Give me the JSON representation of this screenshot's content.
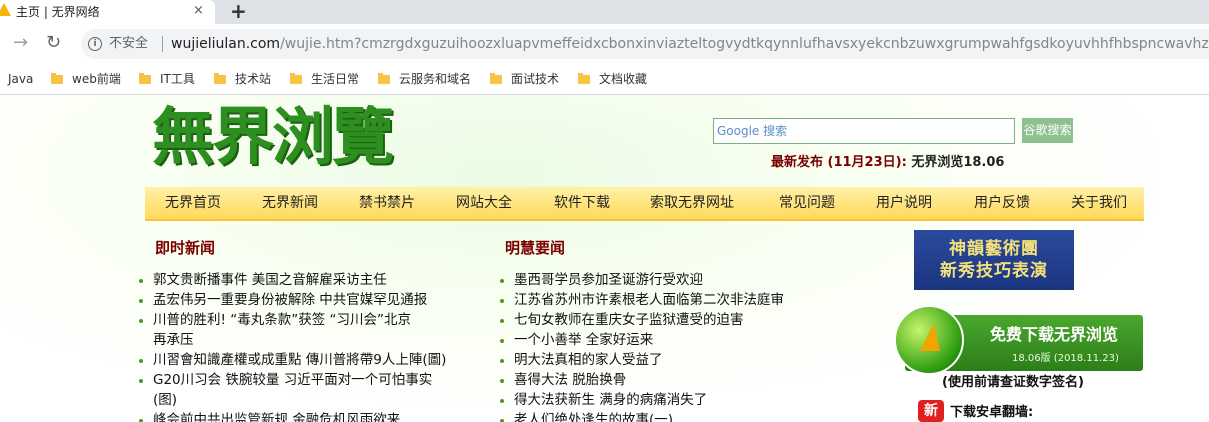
{
  "browser": {
    "tab_title": "主页 | 无界网络",
    "tab_close": "×",
    "new_tab": "+",
    "insecure_label": "不安全",
    "url_host": "wujieliulan.com",
    "url_path": "/wujie.htm?cmzrgdxguzuihoozxluapvmeffeidxcbonxinviazteltogvydtkqynnlufhavsxyekcnbzuwxgrumpwahfgsdkoyuvhhfhbspncwavhzefatyu..."
  },
  "bookmarks": [
    "Java",
    "web前端",
    "IT工具",
    "技术站",
    "生活日常",
    "云服务和域名",
    "面试技术",
    "文档收藏"
  ],
  "header": {
    "logo_text": "無界浏覽",
    "search_placeholder": "Google 搜索",
    "search_button": "谷歌搜索",
    "release_label": "最新发布 (11月23日):",
    "release_version": "无界浏览18.06"
  },
  "menu": [
    "无界首页",
    "无界新闻",
    "禁书禁片",
    "网站大全",
    "软件下载",
    "索取无界网址",
    "常见问题",
    "用户说明",
    "用户反馈",
    "关于我们"
  ],
  "left_column": {
    "title": "即时新闻",
    "items": [
      "郭文贵断播事件 美国之音解雇采访主任",
      "孟宏伟另一重要身份被解除 中共官媒罕见通报",
      "川普的胜利! “毒丸条款”获签 “习川会”北京",
      "再承压",
      "川習會知識產權或成重點 傳川普將帶9人上陣(圖)",
      "G20川习会 铁腕较量 习近平面对一个可怕事实",
      "(图)",
      "峰会前中共出监管新规 金融危机风雨欲来"
    ]
  },
  "middle_column": {
    "title": "明慧要闻",
    "items": [
      "墨西哥学员参加圣诞游行受欢迎",
      "江苏省苏州市许素根老人面临第二次非法庭审",
      "七旬女教师在重庆女子监狱遭受的迫害",
      "一个小善举 全家好运来",
      "明大法真相的家人受益了",
      "喜得大法 脱胎换骨",
      "得大法获新生 满身的病痛消失了",
      "老人们绝处逢生的故事(一)"
    ]
  },
  "sidebar": {
    "banner_line1": "神韻藝術團",
    "banner_line2": "新秀技巧表演",
    "download_text": "免费下载无界浏览",
    "download_version": "18.06版 (2018.11.23)",
    "signature_note": "(使用前请查证数字签名)",
    "new_badge": "新",
    "android_label": "下载安卓翻墙:"
  }
}
